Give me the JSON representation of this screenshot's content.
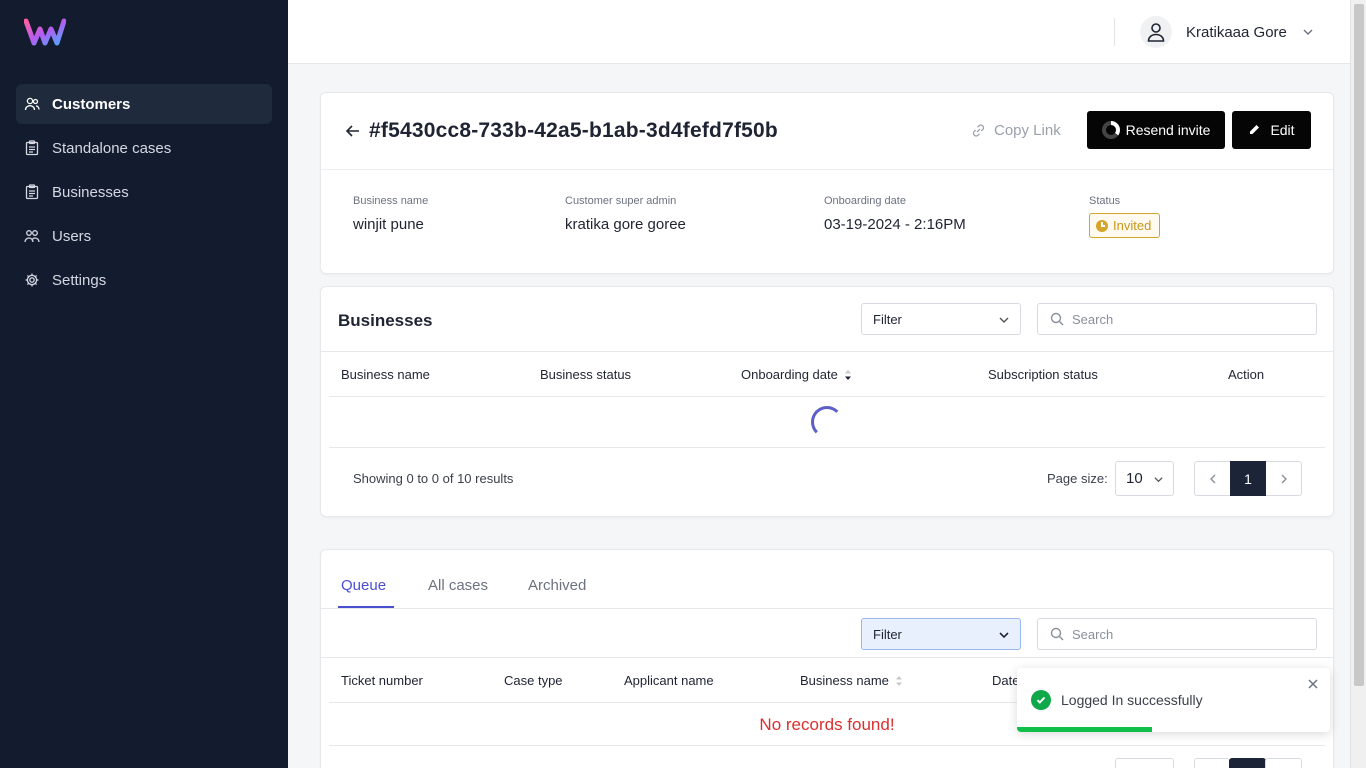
{
  "sidebar": {
    "logo_name": "w-logo",
    "items": [
      {
        "label": "Customers",
        "icon": "users-icon",
        "active": true
      },
      {
        "label": "Standalone cases",
        "icon": "clipboard-icon",
        "active": false
      },
      {
        "label": "Businesses",
        "icon": "clipboard-icon",
        "active": false
      },
      {
        "label": "Users",
        "icon": "users-icon",
        "active": false
      },
      {
        "label": "Settings",
        "icon": "gear-icon",
        "active": false
      }
    ]
  },
  "header": {
    "username": "Kratikaaa Gore",
    "avatar_icon": "user-icon"
  },
  "detail": {
    "id": "#f5430cc8-733b-42a5-b1ab-3d4fefd7f50b",
    "copy_link_label": "Copy Link",
    "resend_label": "Resend invite",
    "edit_label": "Edit",
    "fields": [
      {
        "label": "Business name",
        "value": "winjit pune"
      },
      {
        "label": "Customer super admin",
        "value": "kratika gore goree"
      },
      {
        "label": "Onboarding date",
        "value": "03-19-2024 - 2:16PM"
      },
      {
        "label": "Status",
        "value": "Invited"
      }
    ],
    "status_color": "#d4a52a"
  },
  "businesses": {
    "title": "Businesses",
    "filter_label": "Filter",
    "search_placeholder": "Search",
    "columns": [
      "Business name",
      "Business status",
      "Onboarding date",
      "Subscription status",
      "Action"
    ],
    "rows": [],
    "showing_text": "Showing 0 to 0 of 10 results",
    "page_size_label": "Page size:",
    "page_size": "10",
    "current_page": "1"
  },
  "cases": {
    "tabs": [
      "Queue",
      "All cases",
      "Archived"
    ],
    "active_tab": "Queue",
    "filter_label": "Filter",
    "search_placeholder": "Search",
    "columns": [
      "Ticket number",
      "Case type",
      "Applicant name",
      "Business name",
      "Date"
    ],
    "empty_text": "No records found!"
  },
  "toast": {
    "message": "Logged In successfully",
    "progress": 0.43,
    "color": "#0fbf4a"
  },
  "colors": {
    "sidebar_bg": "#131b2e",
    "accent": "#4a4fd0",
    "primary_button": "#050505",
    "error": "#dc2f2f"
  }
}
